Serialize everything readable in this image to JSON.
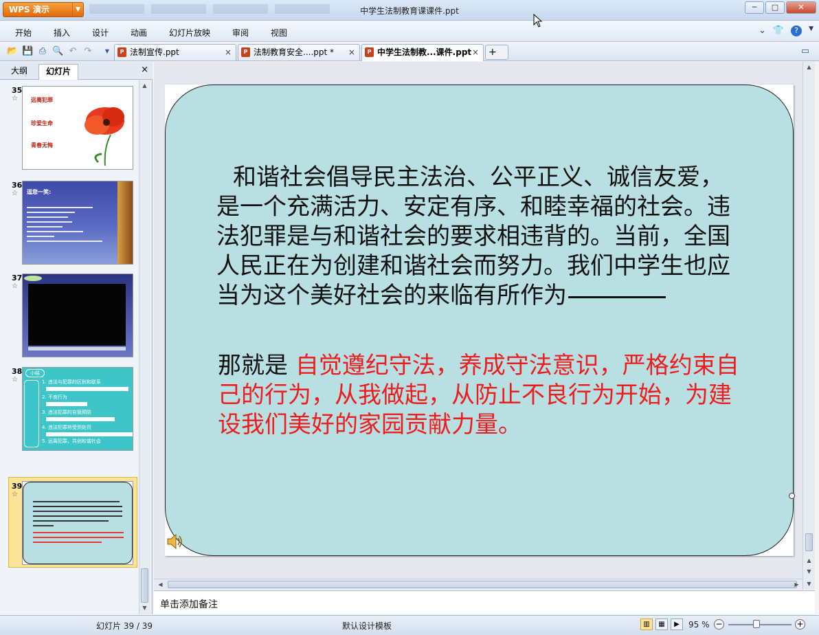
{
  "app": {
    "logo_label": "WPS 演示",
    "window_title": "中学生法制教育课课件.ppt"
  },
  "menu": [
    "开始",
    "插入",
    "设计",
    "动画",
    "幻灯片放映",
    "审阅",
    "视图"
  ],
  "doc_tabs": [
    {
      "label": "法制宣传.ppt",
      "close": "×"
    },
    {
      "label": "法制教育安全....ppt *",
      "close": "×"
    },
    {
      "label": "中学生法制教...课件.ppt",
      "close": "×"
    }
  ],
  "left_panel": {
    "tabs": [
      "大纲",
      "幻灯片"
    ],
    "close": "×",
    "thumbnails": [
      {
        "num": "35",
        "lines": [
          "远离犯罪",
          "珍爱生命",
          "青春无悔"
        ]
      },
      {
        "num": "36",
        "title": "逗您一笑:"
      },
      {
        "num": "37"
      },
      {
        "num": "38",
        "badge": "小结",
        "items": [
          "1. 违法与犯罪的区别和联系",
          "2. 不良行为",
          "3. 违法犯罪的自我预防",
          "4. 违法犯罪将受到处罚",
          "5. 远离犯罪，共创和谐社会"
        ]
      },
      {
        "num": "39"
      }
    ]
  },
  "slide": {
    "paragraph1": "和谐社会倡导民主法治、公平正义、诚信友爱，是一个充满活力、安定有序、和睦幸福的社会。违法犯罪是与和谐社会的要求相违背的。当前，全国人民正在为创建和谐社会而努力。我们中学生也应当为这个美好社会的来临有所作为",
    "lead": "那就是",
    "highlight": "自觉遵纪守法，养成守法意识，严格约束自己的行为，从我做起，从防止不良行为开始，为建设我们美好的家园贡献力量。"
  },
  "notes_placeholder": "单击添加备注",
  "status": {
    "slide_counter": "幻灯片 39 / 39",
    "template": "默认设计模板",
    "zoom": "95 %"
  }
}
